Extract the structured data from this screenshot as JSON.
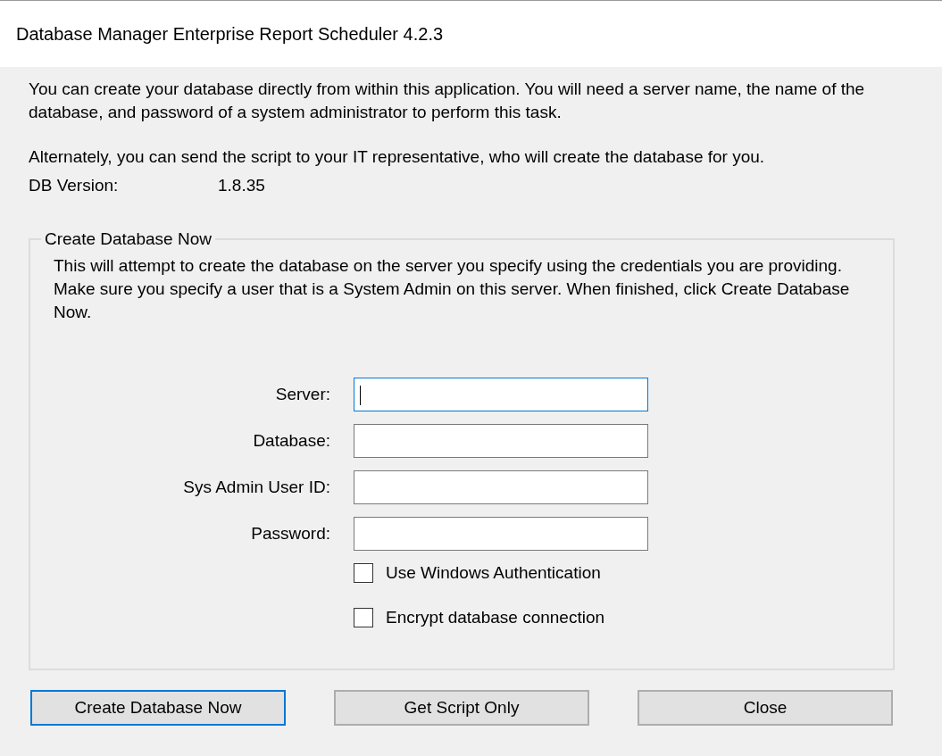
{
  "window": {
    "title": "Database Manager Enterprise Report Scheduler 4.2.3"
  },
  "intro": [
    "You can create your database directly from within this application. You will need a server name, the name of the database, and password of a system administrator to perform this task.",
    "Alternately, you can send the script to your IT representative, who will create the database for you."
  ],
  "db_version": {
    "label": "DB Version:",
    "value": "1.8.35"
  },
  "group": {
    "title": "Create Database Now",
    "description": "This will attempt to create the database on the server you specify using the credentials you are providing.  Make sure you specify a user that is a System Admin on this server. When finished, click Create Database Now.",
    "fields": [
      {
        "label": "Server:",
        "focused": true
      },
      {
        "label": "Database:",
        "focused": false
      },
      {
        "label": "Sys Admin User ID:",
        "focused": false
      },
      {
        "label": "Password:",
        "focused": false
      }
    ],
    "checkboxes": [
      {
        "label": "Use Windows Authentication",
        "checked": false
      },
      {
        "label": "Encrypt database connection",
        "checked": false
      }
    ]
  },
  "buttons": [
    {
      "label": "Create Database Now",
      "focused": true
    },
    {
      "label": "Get Script Only",
      "focused": false
    },
    {
      "label": "Close",
      "focused": false
    }
  ]
}
